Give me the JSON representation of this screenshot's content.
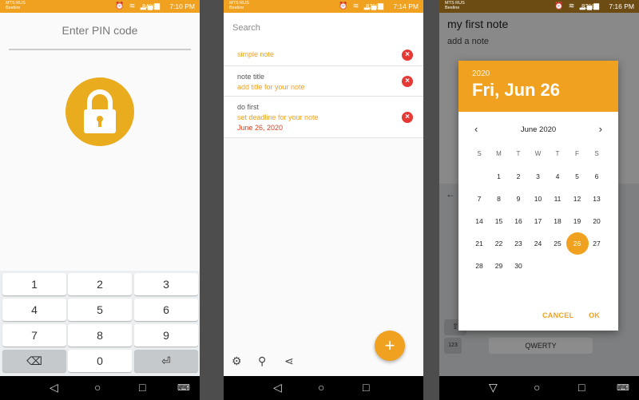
{
  "status_bars": [
    {
      "carrier": "MTS RUS",
      "carrier2": "Beeline",
      "battery": "84%",
      "time": "7:10 PM"
    },
    {
      "carrier": "MTS RUS",
      "carrier2": "Beeline",
      "battery": "83%",
      "time": "7:14 PM"
    },
    {
      "carrier": "MTS RUS",
      "carrier2": "Beeline",
      "battery": "83%",
      "time": "7:16 PM"
    }
  ],
  "pin_screen": {
    "title": "Enter PIN code",
    "keys": [
      "1",
      "2",
      "3",
      "4",
      "5",
      "6",
      "7",
      "8",
      "9",
      "0"
    ],
    "backspace_icon": "backspace-icon",
    "enter_icon": "enter-icon",
    "accent_color": "#e9ac1f"
  },
  "notes_screen": {
    "search_placeholder": "Search",
    "notes": [
      {
        "title": "simple note",
        "subtitle": "",
        "deadline": ""
      },
      {
        "title": "note title",
        "subtitle": "add title for your note",
        "deadline": ""
      },
      {
        "title": "do first",
        "subtitle": "set deadline for your note",
        "deadline": "June 26, 2020"
      }
    ],
    "fab_label": "+",
    "toolbar_icons": [
      "gear-icon",
      "search-icon",
      "share-icon"
    ]
  },
  "date_screen": {
    "note_title": "my first note",
    "note_body": "add a note",
    "picker": {
      "year": "2020",
      "date": "Fri, Jun 26",
      "month": "June 2020",
      "weekdays": [
        "S",
        "M",
        "T",
        "W",
        "T",
        "F",
        "S"
      ],
      "selected_day": "26",
      "cancel": "CANCEL",
      "ok": "OK"
    },
    "keyboard_space_label": "QWERTY",
    "keyboard_num_label": "123"
  },
  "colors": {
    "accent": "#f0a11f",
    "delete": "#e53935"
  }
}
